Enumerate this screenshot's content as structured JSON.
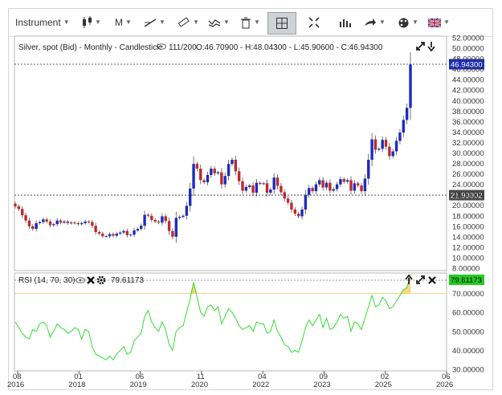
{
  "toolbar": {
    "instrument": "Instrument",
    "interval": "M",
    "language_flag": "uk-flag-icon"
  },
  "chart_data": [
    {
      "type": "candlestick",
      "title": "Silver, spot (Bid) - Monthly - Candlestick",
      "bar_counter": "111/200",
      "ohlc_readout": "O:46.70900 - H:48.04300 - L:45.90600 - C:46.94300",
      "last_price": "46.94300",
      "crosshair_price": "21.93802",
      "ylim": [
        8,
        52
      ],
      "yticks": [
        "52.00000",
        "50.00000",
        "48.00000",
        "46.00000",
        "44.00000",
        "42.00000",
        "40.00000",
        "38.00000",
        "36.00000",
        "34.00000",
        "32.00000",
        "30.00000",
        "28.00000",
        "26.00000",
        "24.00000",
        "22.00000",
        "20.00000",
        "18.00000",
        "16.00000",
        "14.00000",
        "12.00000",
        "10.00000",
        "8.00000"
      ],
      "up_color": "#1c2bbd",
      "down_color": "#c0282d",
      "close": [
        19.8,
        19.3,
        18.1,
        17.1,
        16.0,
        15.5,
        16.6,
        16.8,
        17.3,
        16.9,
        16.2,
        16.4,
        17.1,
        16.7,
        16.9,
        16.6,
        16.7,
        16.6,
        16.4,
        16.6,
        16.9,
        16.8,
        16.1,
        14.9,
        14.6,
        14.1,
        14.1,
        14.5,
        14.2,
        14.6,
        14.8,
        15.1,
        14.3,
        14.4,
        15.2,
        15.5,
        16.1,
        18.2,
        18.0,
        17.2,
        16.9,
        16.7,
        17.9,
        17.0,
        15.1,
        14.0,
        17.6,
        17.8,
        18.0,
        19.9,
        23.2,
        27.9,
        27.0,
        24.8,
        24.4,
        25.8,
        27.0,
        26.1,
        26.3,
        24.0,
        25.6,
        27.9,
        28.7,
        26.5,
        24.6,
        22.8,
        23.5,
        23.8,
        22.4,
        24.3,
        24.1,
        24.2,
        22.4,
        23.0,
        25.3,
        23.7,
        22.5,
        21.3,
        20.5,
        19.2,
        18.4,
        17.9,
        19.2,
        22.0,
        23.3,
        22.7,
        24.0,
        24.8,
        23.4,
        24.3,
        22.8,
        23.1,
        24.0,
        25.0,
        24.5,
        24.8,
        22.8,
        24.2,
        23.8,
        22.7,
        25.1,
        28.7,
        32.6,
        30.6,
        30.8,
        32.5,
        31.2,
        29.4,
        30.3,
        32.3,
        33.9,
        36.3,
        38.6,
        46.9
      ],
      "xticks": [
        {
          "month": "08",
          "year": "2016"
        },
        {
          "month": "01",
          "year": "2018"
        },
        {
          "month": "06",
          "year": "2019"
        },
        {
          "month": "11",
          "year": "2020"
        },
        {
          "month": "04",
          "year": "2022"
        },
        {
          "month": "09",
          "year": "2023"
        },
        {
          "month": "02",
          "year": "2025"
        },
        {
          "month": "06",
          "year": "2026"
        }
      ]
    },
    {
      "type": "line",
      "title": "RSI (14, 70, 30)",
      "value_readout": "79.61173",
      "last_value": "79.61173",
      "ylim": [
        30,
        80
      ],
      "yticks": [
        "70.00000",
        "60.00000",
        "50.00000",
        "40.00000",
        "30.00000"
      ],
      "overbought": 70,
      "oversold": 30,
      "line_color": "#33dd33",
      "values": [
        55,
        52,
        49,
        47,
        46,
        51,
        50,
        54,
        55,
        53,
        47,
        50,
        54,
        52,
        51,
        49,
        50,
        52,
        51,
        46,
        51,
        50,
        42,
        38,
        37,
        36,
        35,
        37,
        35,
        38,
        40,
        42,
        38,
        39,
        45,
        47,
        49,
        58,
        61,
        55,
        52,
        50,
        55,
        51,
        43,
        40,
        50,
        52,
        53,
        60,
        67,
        76,
        68,
        60,
        58,
        63,
        64,
        61,
        63,
        54,
        58,
        62,
        60,
        57,
        53,
        51,
        52,
        53,
        50,
        55,
        54,
        54,
        49,
        50,
        56,
        50,
        47,
        43,
        42,
        39,
        40,
        39,
        45,
        52,
        56,
        53,
        56,
        59,
        52,
        57,
        51,
        52,
        55,
        59,
        57,
        58,
        50,
        55,
        54,
        51,
        57,
        63,
        69,
        63,
        64,
        68,
        66,
        62,
        63,
        66,
        69,
        72,
        73,
        80
      ]
    }
  ]
}
